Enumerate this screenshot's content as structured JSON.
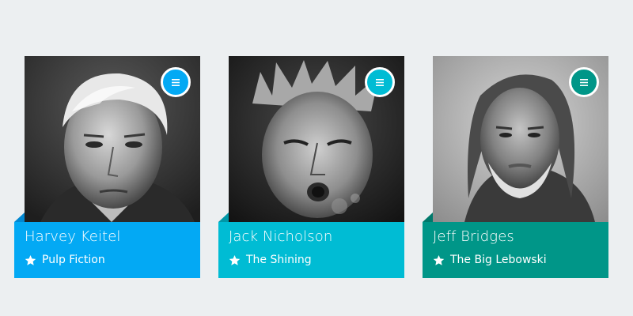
{
  "cards": [
    {
      "name": "Harvey Keitel",
      "movie": "Pulp Fiction",
      "accent": "#03a9f4",
      "fold": "#0288d1",
      "star_icon": "star-icon",
      "menu_icon": "menu-icon",
      "photo": "portrait-photo"
    },
    {
      "name": "Jack Nicholson",
      "movie": "The Shining",
      "accent": "#00bcd4",
      "fold": "#0097a7",
      "star_icon": "star-icon",
      "menu_icon": "menu-icon",
      "photo": "portrait-photo"
    },
    {
      "name": "Jeff Bridges",
      "movie": "The Big Lebowski",
      "accent": "#009688",
      "fold": "#00796b",
      "star_icon": "star-icon",
      "menu_icon": "menu-icon",
      "photo": "portrait-photo"
    }
  ]
}
